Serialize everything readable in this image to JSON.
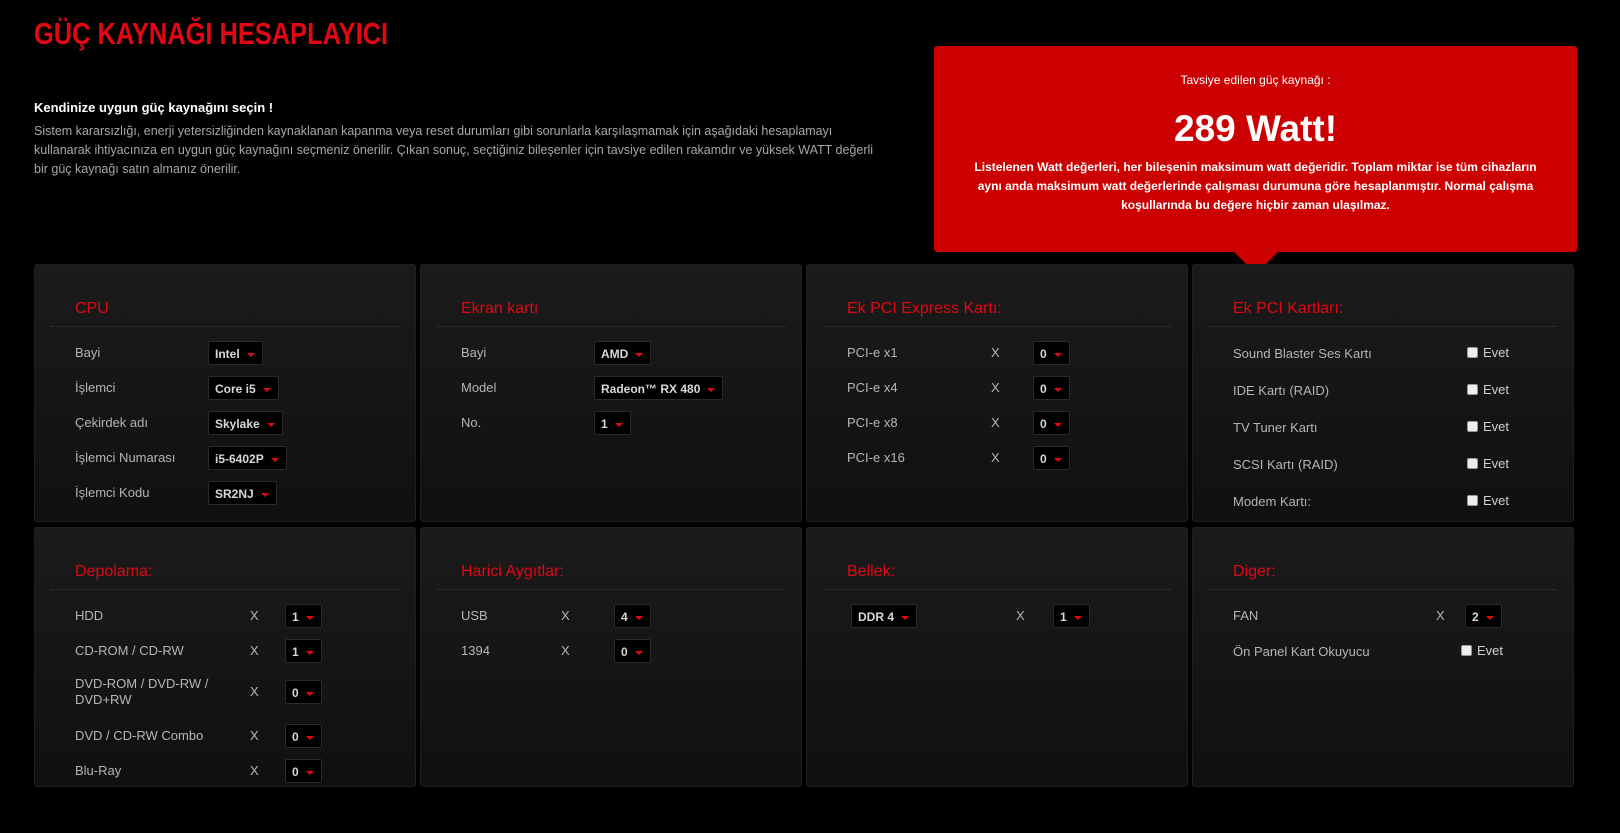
{
  "title": "GÜÇ KAYNAĞI HESAPLAYICI",
  "intro": {
    "heading": "Kendinize uygun güç kaynağını seçin !",
    "text": "Sistem kararsızlığı, enerji yetersizliğinden kaynaklanan kapanma veya reset durumları gibi sorunlarla karşılaşmamak için aşağıdaki hesaplamayı kullanarak ihtiyacınıza en uygun güç kaynağını seçmeniz önerilir. Çıkan sonuç, seçtiğiniz bileşenler için tavsiye edilen rakamdır ve yüksek WATT değerli bir güç kaynağı satın almanız önerilir."
  },
  "recommendation": {
    "label": "Tavsiye edilen güç kaynağı :",
    "value": "289 Watt!",
    "description": "Listelenen Watt değerleri, her bileşenin maksimum watt değeridir. Toplam miktar ise tüm cihazların aynı anda maksimum watt değerlerinde çalışması durumuna göre hesaplanmıştır. Normal çalışma koşullarında bu değere hiçbir zaman ulaşılmaz."
  },
  "x_symbol": "X",
  "check_label": "Evet",
  "cpu": {
    "title": "CPU",
    "rows": [
      {
        "label": "Bayi",
        "value": "Intel"
      },
      {
        "label": "İşlemci",
        "value": "Core i5"
      },
      {
        "label": "Çekirdek adı",
        "value": "Skylake"
      },
      {
        "label": "İşlemci Numarası",
        "value": "i5-6402P"
      },
      {
        "label": "İşlemci Kodu",
        "value": "SR2NJ"
      }
    ]
  },
  "gpu": {
    "title": "Ekran kartı",
    "rows": [
      {
        "label": "Bayi",
        "value": "AMD"
      },
      {
        "label": "Model",
        "value": "Radeon™ RX 480"
      },
      {
        "label": "No.",
        "value": "1"
      }
    ]
  },
  "pcie": {
    "title": "Ek PCI Express Kartı:",
    "rows": [
      {
        "label": "PCI-e x1",
        "value": "0"
      },
      {
        "label": "PCI-e x4",
        "value": "0"
      },
      {
        "label": "PCI-e x8",
        "value": "0"
      },
      {
        "label": "PCI-e x16",
        "value": "0"
      }
    ]
  },
  "pci": {
    "title": "Ek PCI Kartları:",
    "rows": [
      {
        "label": "Sound Blaster Ses Kartı"
      },
      {
        "label": "IDE Kartı (RAID)"
      },
      {
        "label": "TV Tuner Kartı"
      },
      {
        "label": "SCSI Kartı (RAID)"
      },
      {
        "label": "Modem Kartı:"
      }
    ]
  },
  "storage": {
    "title": "Depolama:",
    "rows": [
      {
        "label": "HDD",
        "value": "1"
      },
      {
        "label": "CD-ROM / CD-RW",
        "value": "1"
      },
      {
        "label": "DVD-ROM / DVD-RW / DVD+RW",
        "value": "0"
      },
      {
        "label": "DVD / CD-RW Combo",
        "value": "0"
      },
      {
        "label": "Blu-Ray",
        "value": "0"
      }
    ]
  },
  "external": {
    "title": "Harici Aygıtlar:",
    "rows": [
      {
        "label": "USB",
        "value": "4"
      },
      {
        "label": "1394",
        "value": "0"
      }
    ]
  },
  "memory": {
    "title": "Bellek:",
    "type": "DDR 4",
    "count": "1"
  },
  "other": {
    "title": "Diger:",
    "fan_label": "FAN",
    "fan_value": "2",
    "card_reader_label": "Ön Panel Kart Okuyucu"
  }
}
